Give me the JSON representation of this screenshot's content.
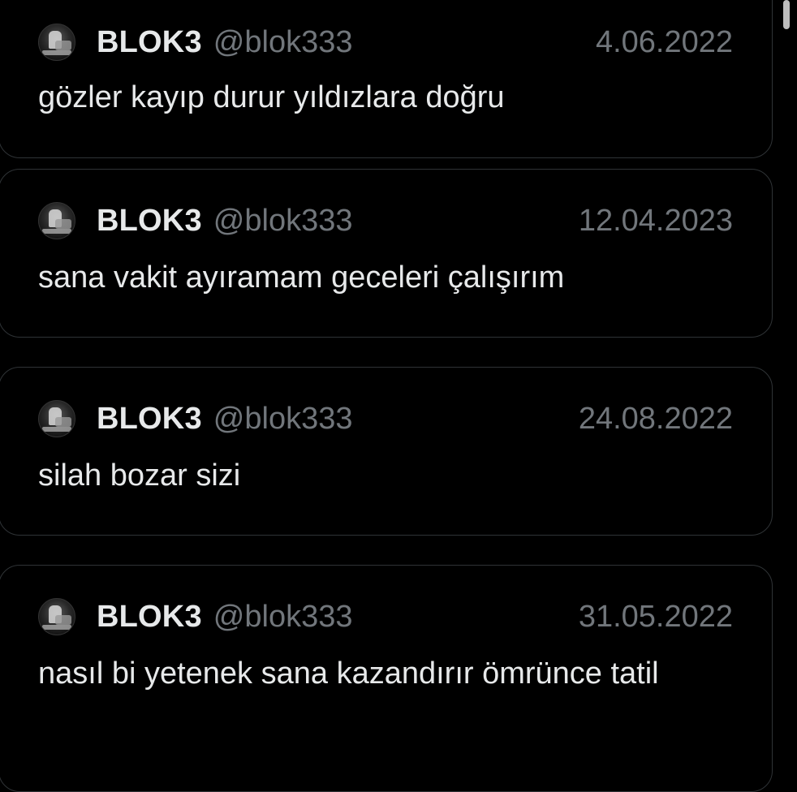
{
  "posts": [
    {
      "author": {
        "name": "BLOK3",
        "handle": "@blok333",
        "avatar_icon": "avatar-photo"
      },
      "date": "4.06.2022",
      "text": "gözler kayıp durur yıldızlara doğru"
    },
    {
      "author": {
        "name": "BLOK3",
        "handle": "@blok333",
        "avatar_icon": "avatar-photo"
      },
      "date": "12.04.2023",
      "text": "sana vakit ayıramam geceleri çalışırım"
    },
    {
      "author": {
        "name": "BLOK3",
        "handle": "@blok333",
        "avatar_icon": "avatar-photo"
      },
      "date": "24.08.2022",
      "text": "silah bozar sizi"
    },
    {
      "author": {
        "name": "BLOK3",
        "handle": "@blok333",
        "avatar_icon": "avatar-photo"
      },
      "date": "31.05.2022",
      "text": "nasıl bi yetenek sana kazandırır ömrünce tatil"
    }
  ],
  "colors": {
    "background": "#000000",
    "card_border": "#2f3336",
    "primary_text": "#e7e9ea",
    "secondary_text": "#71767b"
  }
}
